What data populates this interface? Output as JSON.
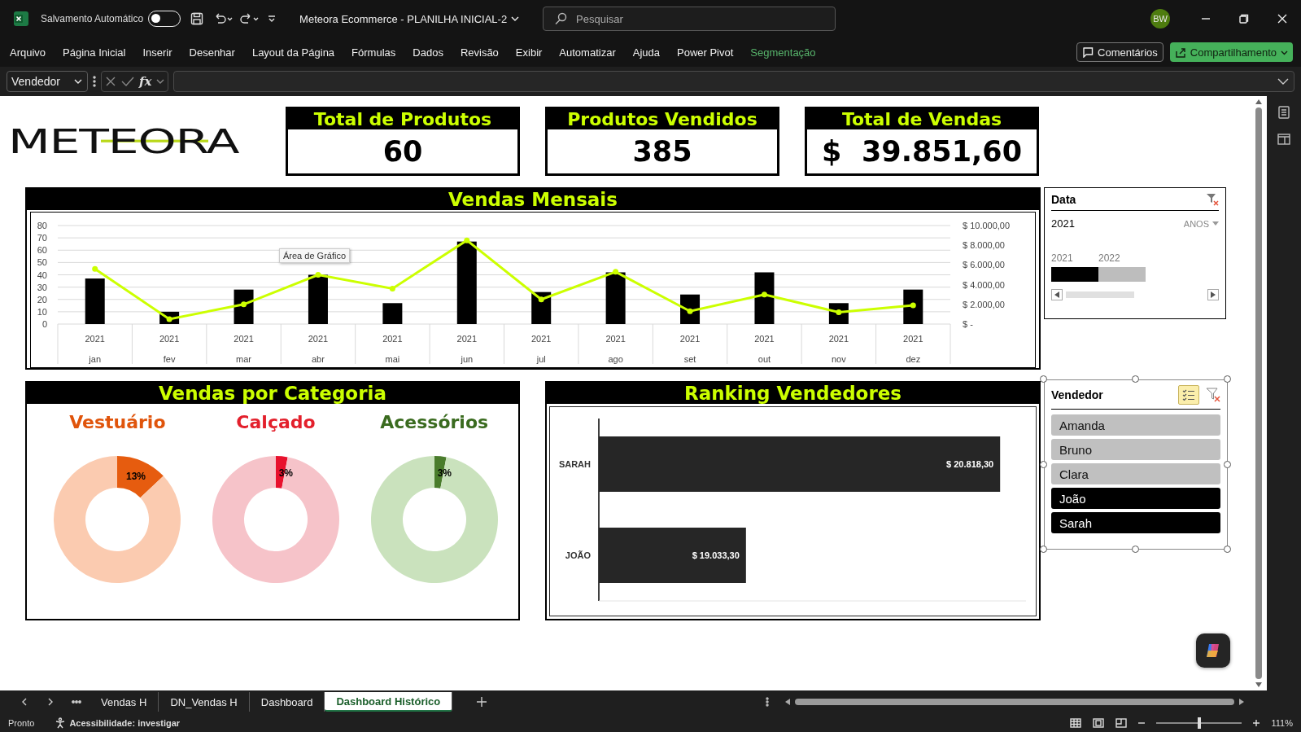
{
  "titlebar": {
    "autosave_label": "Salvamento Automático",
    "autosave_on": false,
    "document_title": "Meteora Ecommerce - PLANILHA INICIAL-2",
    "search_placeholder": "Pesquisar",
    "avatar": "BW"
  },
  "ribbon_tabs": [
    {
      "label": "Arquivo",
      "kind": "tab"
    },
    {
      "label": "Página Inicial",
      "kind": "tab"
    },
    {
      "label": "Inserir",
      "kind": "tab"
    },
    {
      "label": "Desenhar",
      "kind": "tab"
    },
    {
      "label": "Layout da Página",
      "kind": "tab"
    },
    {
      "label": "Fórmulas",
      "kind": "tab"
    },
    {
      "label": "Dados",
      "kind": "tab"
    },
    {
      "label": "Revisão",
      "kind": "tab"
    },
    {
      "label": "Exibir",
      "kind": "tab"
    },
    {
      "label": "Automatizar",
      "kind": "tab"
    },
    {
      "label": "Ajuda",
      "kind": "tab"
    },
    {
      "label": "Power Pivot",
      "kind": "tab"
    },
    {
      "label": "Segmentação",
      "kind": "contextual"
    }
  ],
  "ribbon_buttons": {
    "comments": "Comentários",
    "share": "Compartilhamento"
  },
  "formula_bar": {
    "name_box": "Vendedor",
    "function_label": "fx"
  },
  "logo": "METEORA",
  "kpis": [
    {
      "title": "Total de Produtos",
      "value": "60"
    },
    {
      "title": "Produtos Vendidos",
      "value": "385"
    },
    {
      "title": "Total de Vendas",
      "currency": "$",
      "value": "39.851,60"
    }
  ],
  "monthly_sales": {
    "title": "Vendas Mensais",
    "tooltip": "Área de Gráfico",
    "year_labels": [
      "2021",
      "2021",
      "2021",
      "2021",
      "2021",
      "2021",
      "2021",
      "2021",
      "2021",
      "2021",
      "2021",
      "2021"
    ],
    "quantity": {
      "chart_data": {
        "type": "bar",
        "categories": [
          "jan",
          "fev",
          "mar",
          "abr",
          "mai",
          "jun",
          "jul",
          "ago",
          "set",
          "out",
          "nov",
          "dez"
        ],
        "ylim": [
          0,
          80
        ],
        "yticks": [
          0,
          10,
          20,
          30,
          40,
          50,
          60,
          70,
          80
        ],
        "grid": true,
        "series": [
          {
            "color": "#000000",
            "values": [
              37,
              10,
              28,
              40,
              17,
              67,
              26,
              42,
              24,
              42,
              17,
              28
            ]
          }
        ]
      }
    },
    "sales": {
      "chart_data": {
        "type": "line",
        "ylim": [
          0,
          10000
        ],
        "yticks": [
          {
            "value": 0,
            "label": "$ -"
          },
          {
            "value": 2000,
            "label": "$ 2.000,00"
          },
          {
            "value": 4000,
            "label": "$ 4.000,00"
          },
          {
            "value": 6000,
            "label": "$ 6.000,00"
          },
          {
            "value": 8000,
            "label": "$ 8.000,00"
          },
          {
            "value": 10000,
            "label": "$ 10.000,00"
          }
        ],
        "series": [
          {
            "color": "#ccff00",
            "marker": true,
            "values": [
              5600,
              500,
              2000,
              5000,
              3600,
              8500,
              2500,
              5300,
              1300,
              3000,
              1200,
              1900
            ]
          }
        ]
      }
    }
  },
  "date_slicer": {
    "title": "Data",
    "selection": "2021",
    "level_label": "ANOS",
    "periods": [
      {
        "label": "2021",
        "selected": true
      },
      {
        "label": "2022",
        "selected": false
      }
    ]
  },
  "category_sales": {
    "title": "Vendas por Categoria",
    "categories": [
      {
        "name": "Vestuário",
        "color": "#e0540b",
        "chart_data": {
          "type": "donut",
          "values": [
            13,
            87
          ],
          "colors": [
            "#e65c0f",
            "#fbcbb0"
          ],
          "value_labels": [
            "13%",
            null
          ]
        }
      },
      {
        "name": "Calçado",
        "color": "#e3202c",
        "chart_data": {
          "type": "donut",
          "values": [
            3,
            97
          ],
          "colors": [
            "#e8112d",
            "#f6c3c9"
          ],
          "value_labels": [
            "3%",
            null
          ]
        }
      },
      {
        "name": "Acessórios",
        "color": "#3a6b1f",
        "chart_data": {
          "type": "donut",
          "values": [
            3,
            97
          ],
          "colors": [
            "#4a7c2c",
            "#cae2bd"
          ],
          "value_labels": [
            "3%",
            null
          ]
        }
      }
    ]
  },
  "ranking": {
    "title": "Ranking Vendedores",
    "chart_data": {
      "type": "bar",
      "orientation": "horizontal",
      "categories": [
        "SARAH",
        "JOÃO"
      ],
      "values": [
        20818.3,
        19033.3
      ],
      "xlim": [
        18000,
        21000
      ],
      "value_labels": [
        "$ 20.818,30",
        "$ 19.033,30"
      ]
    }
  },
  "seller_slicer": {
    "title": "Vendedor",
    "multi_select": true,
    "items": [
      {
        "label": "Amanda",
        "selected": false
      },
      {
        "label": "Bruno",
        "selected": false
      },
      {
        "label": "Clara",
        "selected": false
      },
      {
        "label": "João",
        "selected": true
      },
      {
        "label": "Sarah",
        "selected": true
      }
    ]
  },
  "sheet_tabs": [
    {
      "label": "Vendas H",
      "selected": false
    },
    {
      "label": "DN_Vendas H",
      "selected": false
    },
    {
      "label": "Dashboard",
      "selected": false
    },
    {
      "label": "Dashboard Histórico",
      "selected": true
    }
  ],
  "status_bar": {
    "status": "Pronto",
    "accessibility": "Acessibilidade: investigar",
    "zoom": "111%",
    "zoom_slider": {
      "level": 0.5
    }
  }
}
